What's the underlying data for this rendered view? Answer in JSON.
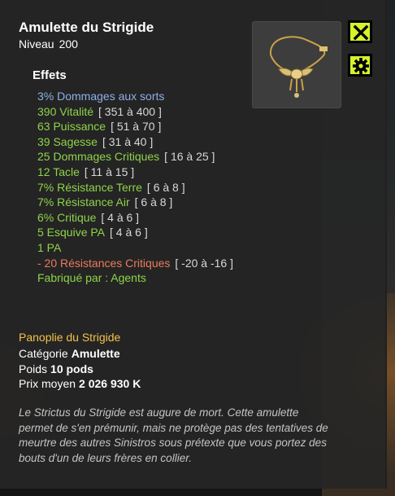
{
  "item": {
    "name": "Amulette du Strigide",
    "level_label": "Niveau",
    "level_value": "200",
    "effects_title": "Effets",
    "effects": [
      {
        "text": "3% Dommages aux sorts",
        "range": "",
        "color": "#8cb0e8"
      },
      {
        "text": "390 Vitalité",
        "range": "[ 351 à 400 ]",
        "color": "#8fd34a"
      },
      {
        "text": "63 Puissance",
        "range": "[ 51 à 70 ]",
        "color": "#8fd34a"
      },
      {
        "text": "39 Sagesse",
        "range": "[ 31 à 40 ]",
        "color": "#8fd34a"
      },
      {
        "text": "25 Dommages Critiques",
        "range": "[ 16 à 25 ]",
        "color": "#8fd34a"
      },
      {
        "text": "12 Tacle",
        "range": "[ 11 à 15 ]",
        "color": "#8fd34a"
      },
      {
        "text": "7% Résistance Terre",
        "range": "[ 6 à 8 ]",
        "color": "#8fd34a"
      },
      {
        "text": "7% Résistance Air",
        "range": "[ 6 à 8 ]",
        "color": "#8fd34a"
      },
      {
        "text": "6% Critique",
        "range": "[ 4 à 6 ]",
        "color": "#8fd34a"
      },
      {
        "text": " 5 Esquive PA",
        "range": "[ 4 à 6 ]",
        "color": "#8fd34a"
      },
      {
        "text": "1 PA",
        "range": "",
        "color": "#8fd34a"
      },
      {
        "text": "- 20 Résistances Critiques",
        "range": "[ -20 à -16 ]",
        "color": "#ec7a5c"
      },
      {
        "text": "Fabriqué par : Agents",
        "range": "",
        "color": "#8fd34a"
      }
    ],
    "set_name": "Panoplie du Strigide",
    "category_label": "Catégorie",
    "category_value": "Amulette",
    "weight_label": "Poids",
    "weight_value": "10 pods",
    "price_label": "Prix moyen",
    "price_value": "2 026 930 K",
    "description": "Le Strictus du Strigide est augure de mort. Cette amulette permet de s'en prémunir, mais ne protège pas des tentatives de meurtre des autres Sinistros sous prétexte que vous portez des bouts d'un de leurs frères en collier."
  },
  "buttons": {
    "close_icon": "close-icon",
    "settings_icon": "gear-icon",
    "accent": "#d7f22a"
  }
}
